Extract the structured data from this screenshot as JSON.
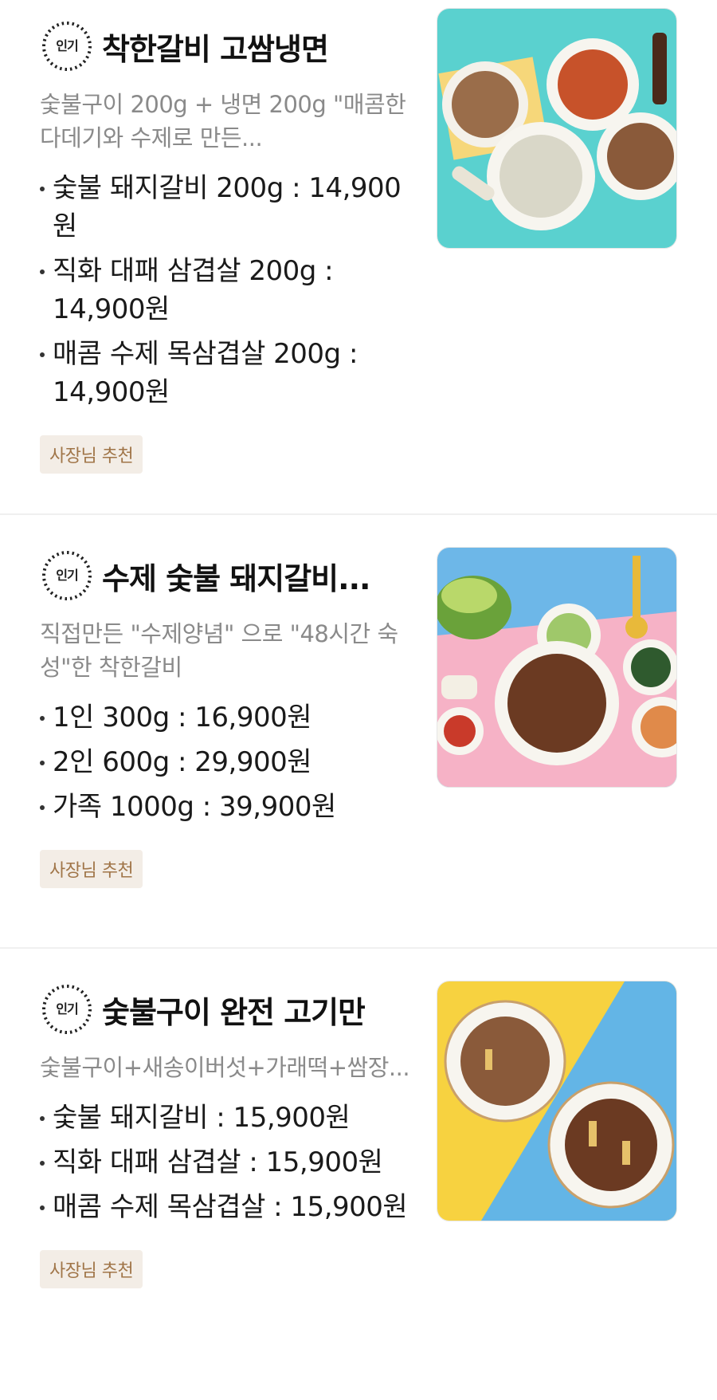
{
  "menu": [
    {
      "badge": "인기",
      "title": "착한갈비 고쌈냉면",
      "description": "숯불구이 200g + 냉면 200g \"매콤한 다데기와 수제로 만든...",
      "prices": [
        "숯불 돼지갈비 200g : 14,900원",
        "직화 대패 삼겹살 200g : 14,900원",
        "매콤 수제 목삼겹살 200g : 14,900원"
      ],
      "tag": "사장님 추천",
      "photo_icon": "food-photo-naengmyeon-set",
      "photo_colors": [
        "#5ad1cf",
        "#f6d77a"
      ]
    },
    {
      "badge": "인기",
      "title": "수제 숯불 돼지갈비...",
      "description": "직접만든 \"수제양념\" 으로 \"48시간 숙성\"한 착한갈비",
      "prices": [
        "1인 300g : 16,900원",
        "2인 600g : 29,900원",
        "가족 1000g : 39,900원"
      ],
      "tag": "사장님 추천",
      "photo_icon": "food-photo-galbi-table",
      "photo_colors": [
        "#6db7e8",
        "#f6b2c6"
      ]
    },
    {
      "badge": "인기",
      "title": "숯불구이 완전 고기만",
      "description": "숯불구이+새송이버섯+가래떡+쌈장...",
      "prices": [
        "숯불 돼지갈비 : 15,900원",
        "직화 대패 삼겹살 : 15,900원",
        "매콤 수제 목삼겹살 : 15,900원"
      ],
      "tag": "사장님 추천",
      "photo_icon": "food-photo-meat-plates",
      "photo_colors": [
        "#f7d240",
        "#63b5e6"
      ]
    }
  ]
}
